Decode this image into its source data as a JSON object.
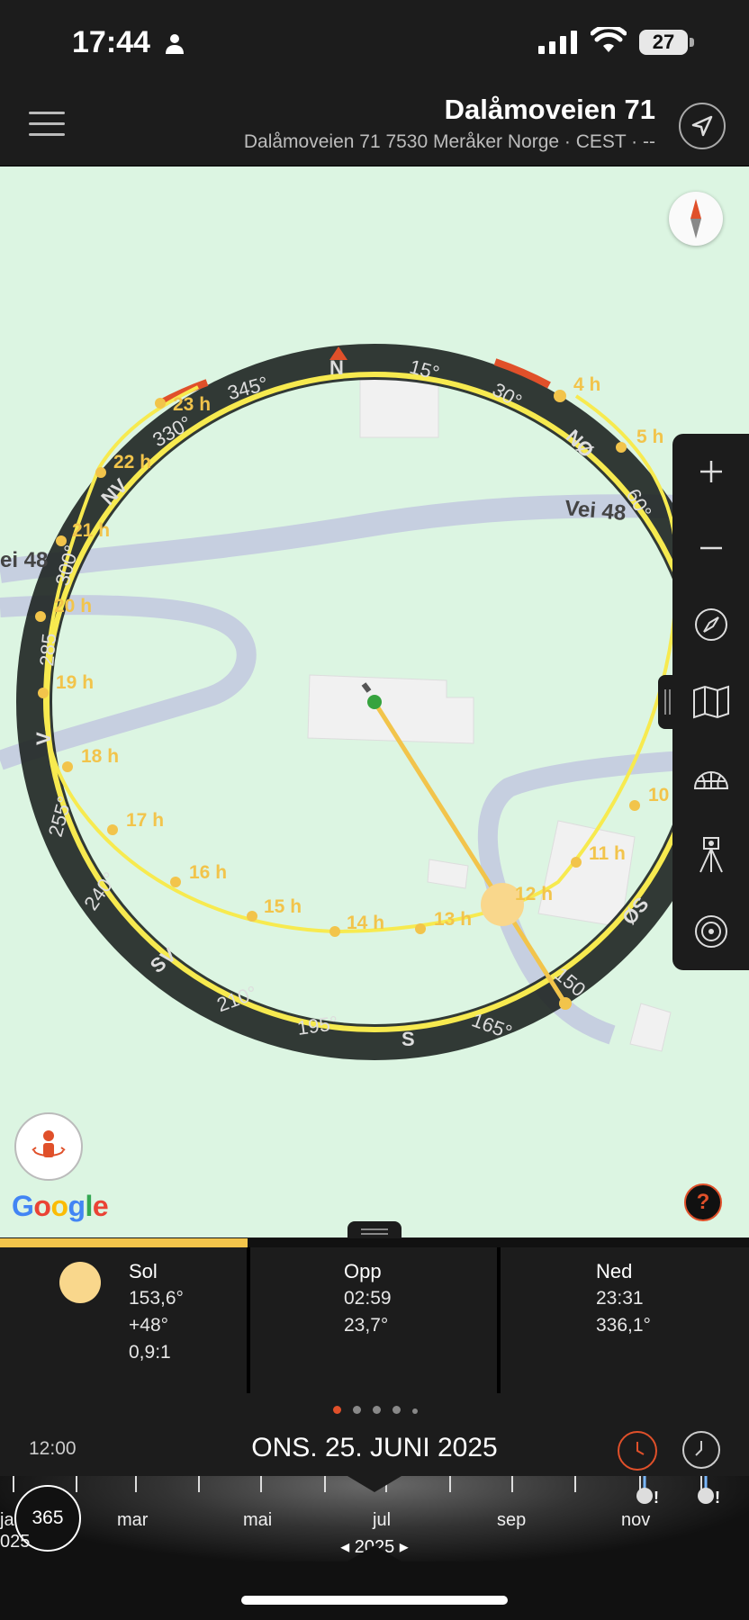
{
  "status_bar": {
    "time": "17:44",
    "battery": "27"
  },
  "header": {
    "title": "Dalåmoveien 71",
    "subtitle": "Dalåmoveien 71 7530 Meråker Norge · CEST · --"
  },
  "map": {
    "road_labels": [
      "Vei 48",
      "ei 48"
    ],
    "compass_labels": [
      "N",
      "15°",
      "30°",
      "NØ",
      "60°",
      "345°",
      "330°",
      "NV",
      "300°",
      "285",
      "V",
      "255°",
      "240°",
      "SV",
      "210°",
      "195°",
      "S",
      "165°",
      "150",
      "ØS"
    ],
    "hour_labels": [
      "4 h",
      "5 h",
      "23 h",
      "22 h",
      "21 h",
      "20 h",
      "19 h",
      "18 h",
      "17 h",
      "16 h",
      "15 h",
      "14 h",
      "13 h",
      "12 h",
      "11 h",
      "10"
    ],
    "google_logo": "Google",
    "help": "?"
  },
  "toolbar": {
    "items": [
      "zoom-in",
      "zoom-out",
      "compass",
      "map-layers",
      "globe",
      "surveyor",
      "target"
    ]
  },
  "info": {
    "sun": {
      "label": "Sol",
      "azimuth": "153,6°",
      "elevation": "+48°",
      "ratio": "0,9:1"
    },
    "rise": {
      "label": "Opp",
      "time": "02:59",
      "azimuth": "23,7°"
    },
    "set": {
      "label": "Ned",
      "time": "23:31",
      "azimuth": "336,1°"
    },
    "progress_fraction": 0.33
  },
  "date": {
    "time": "12:00",
    "main": "ONS. 25. JUNI 2025",
    "page_dots": 5,
    "active_dot": 0
  },
  "timeline": {
    "day_count": "365",
    "months": [
      "ja",
      "mar",
      "mai",
      "jul",
      "sep",
      "nov"
    ],
    "partial_year": "025",
    "year": "◂ 2025 ▸"
  },
  "colors": {
    "accent": "#e0502a",
    "sun_yellow": "#f2c44b",
    "map_bg": "#dcf5e2",
    "panel": "#1c1c1c"
  }
}
